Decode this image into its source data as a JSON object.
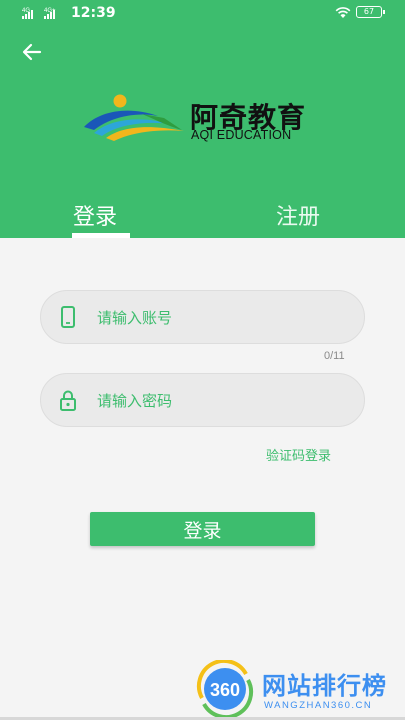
{
  "status_bar": {
    "network_left": "4G",
    "network_right": "4G+",
    "time": "12:39",
    "battery": "67"
  },
  "brand": {
    "name_cn": "阿奇教育",
    "name_en": "AQI EDUCATION"
  },
  "tabs": [
    {
      "label": "登录",
      "active": true
    },
    {
      "label": "注册",
      "active": false
    }
  ],
  "form": {
    "account_placeholder": "请输入账号",
    "account_value": "",
    "account_counter": "0/11",
    "password_placeholder": "请输入密码",
    "password_value": "",
    "sms_login_link": "验证码登录",
    "submit_label": "登录"
  },
  "watermark": {
    "badge": "360",
    "title": "网站排行榜",
    "subtitle": "WANGZHAN360.CN"
  },
  "colors": {
    "primary": "#3dbd6e",
    "watermark": "#3d8ff0"
  }
}
